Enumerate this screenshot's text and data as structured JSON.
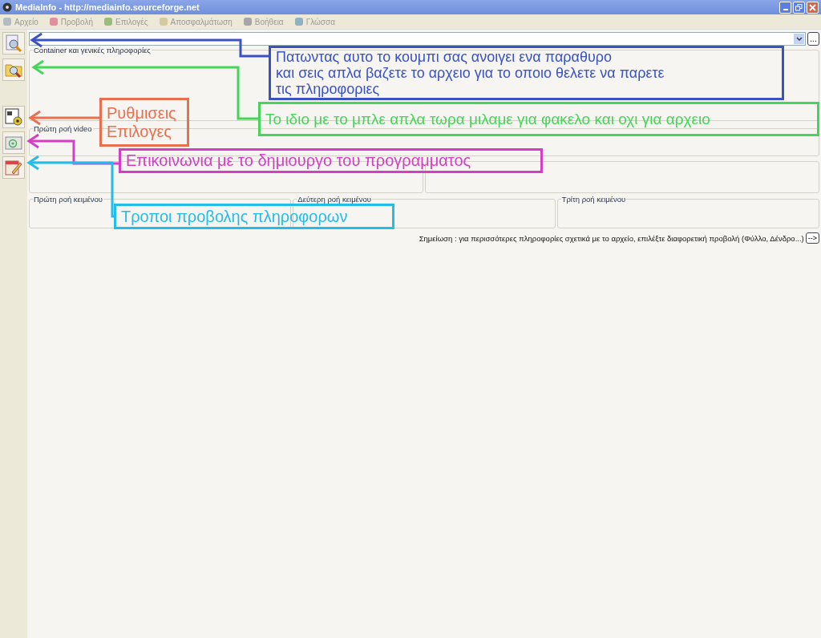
{
  "window": {
    "title": "MediaInfo - http://mediainfo.sourceforge.net"
  },
  "menu": [
    {
      "label": "Αρχείο"
    },
    {
      "label": "Προβολή"
    },
    {
      "label": "Επιλογές"
    },
    {
      "label": "Αποσφαλμάτωση"
    },
    {
      "label": "Βοήθεια"
    },
    {
      "label": "Γλώσσα"
    }
  ],
  "file_selector": {
    "browse_button": "..."
  },
  "panels": {
    "general": "Container και γενικές πληροφορίες",
    "video": "Πρώτη ροή video",
    "text": [
      "Πρώτη ροή κειμένου",
      "Δεύτερη ροή κειμένου",
      "Τρίτη ροή κειμένου"
    ]
  },
  "note": {
    "text": "Σημείωση : για περισσότερες πληροφορίες σχετικά με το αρχείο, επιλέξτε διαφορετική προβολή (Φύλλο, Δένδρο...)",
    "button": "-->"
  },
  "annotations": [
    {
      "color": "#3a52c4",
      "lines": [
        "Πατωντας αυτο το κουμπι σας ανοιγει ενα παραθυρο",
        "και σεις απλα βαζετε το αρχειο για το οποιο θελετε να παρετε",
        "τις πληροφοριες"
      ]
    },
    {
      "color": "#e8704f",
      "lines": [
        "Ρυθμισεις",
        "Επιλογες"
      ]
    },
    {
      "color": "#44d658",
      "lines": [
        "Το ιδιο με το μπλε απλα τωρα μιλαμε για φακελο και οχι για αρχειο"
      ]
    },
    {
      "color": "#d43ec4",
      "lines": [
        "Επικοινωνια με το δημιουργο του προγραμματος"
      ]
    },
    {
      "color": "#22bde8",
      "lines": [
        "Τροποι προβολης πληροφορων"
      ]
    }
  ]
}
